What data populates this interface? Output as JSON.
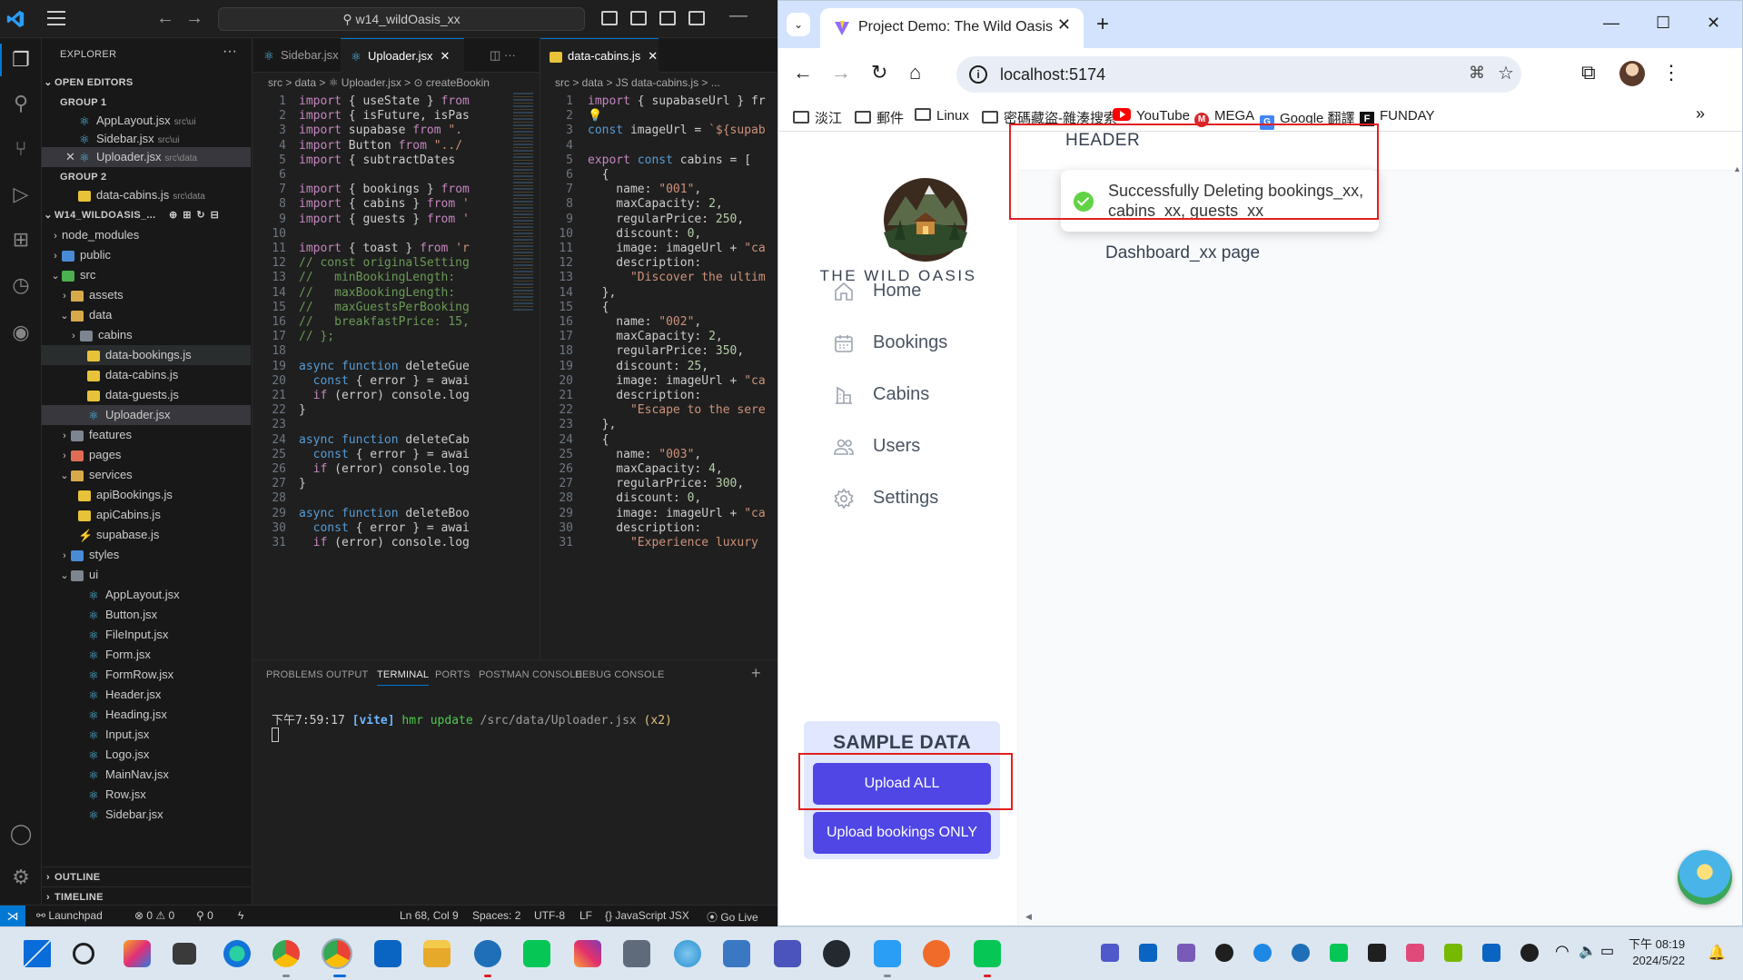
{
  "vscode": {
    "search": "w14_wildOasis_xx",
    "explorer": {
      "title": "EXPLORER",
      "open_editors": "OPEN EDITORS",
      "group1": "GROUP 1",
      "group2": "GROUP 2",
      "g1_files": [
        {
          "name": "AppLayout.jsx",
          "path": "src\\ui"
        },
        {
          "name": "Sidebar.jsx",
          "path": "src\\ui"
        },
        {
          "name": "Uploader.jsx",
          "path": "src\\data"
        }
      ],
      "g2_files": [
        {
          "name": "data-cabins.js",
          "path": "src\\data"
        }
      ],
      "project": "W14_WILDOASIS_...",
      "tree": [
        "node_modules",
        "public",
        "src",
        "assets",
        "data",
        "cabins",
        "data-bookings.js",
        "data-cabins.js",
        "data-guests.js",
        "Uploader.jsx",
        "features",
        "pages",
        "services",
        "apiBookings.js",
        "apiCabins.js",
        "supabase.js",
        "styles",
        "ui",
        "AppLayout.jsx",
        "Button.jsx",
        "FileInput.jsx",
        "Form.jsx",
        "FormRow.jsx",
        "Header.jsx",
        "Heading.jsx",
        "Input.jsx",
        "Logo.jsx",
        "MainNav.jsx",
        "Row.jsx",
        "Sidebar.jsx"
      ],
      "outline": "OUTLINE",
      "timeline": "TIMELINE"
    },
    "editor1": {
      "tabs": [
        "Sidebar.jsx",
        "Uploader.jsx"
      ],
      "crumb": "src > data > ⚛ Uploader.jsx > ⊙ createBookin",
      "lines": [
        "import { useState } from",
        "import { isFuture, isPas",
        "import supabase from \".",
        "import Button from \"../",
        "import { subtractDates",
        "",
        "import { bookings } from",
        "import { cabins } from '",
        "import { guests } from '",
        "",
        "import { toast } from 'r",
        "// const originalSetting",
        "//   minBookingLength: ",
        "//   maxBookingLength: ",
        "//   maxGuestsPerBooking",
        "//   breakfastPrice: 15,",
        "// };",
        "",
        "async function deleteGue",
        "  const { error } = awai",
        "  if (error) console.log",
        "}",
        "",
        "async function deleteCab",
        "  const { error } = awai",
        "  if (error) console.log",
        "}",
        "",
        "async function deleteBoo",
        "  const { error } = awai",
        "  if (error) console.log"
      ]
    },
    "editor2": {
      "tab": "data-cabins.js",
      "crumb": "src > data > JS data-cabins.js > ...",
      "lines": [
        "import { supabaseUrl } fr",
        "💡",
        "const imageUrl = `${supab",
        "",
        "export const cabins = [",
        "  {",
        "    name: \"001\",",
        "    maxCapacity: 2,",
        "    regularPrice: 250,",
        "    discount: 0,",
        "    image: imageUrl + \"ca",
        "    description:",
        "      \"Discover the ultim",
        "  },",
        "  {",
        "    name: \"002\",",
        "    maxCapacity: 2,",
        "    regularPrice: 350,",
        "    discount: 25,",
        "    image: imageUrl + \"ca",
        "    description:",
        "      \"Escape to the sere",
        "  },",
        "  {",
        "    name: \"003\",",
        "    maxCapacity: 4,",
        "    regularPrice: 300,",
        "    discount: 0,",
        "    image: imageUrl + \"ca",
        "    description:",
        "      \"Experience luxury"
      ]
    },
    "panel": {
      "tabs": [
        "PROBLEMS",
        "OUTPUT",
        "TERMINAL",
        "PORTS",
        "POSTMAN CONSOLE",
        "DEBUG CONSOLE"
      ],
      "terminal_time": "下午7:59:17",
      "terminal_tag": "[vite]",
      "terminal_msg": "hmr update",
      "terminal_path": "/src/data/Uploader.jsx",
      "terminal_count": "(x2)"
    },
    "status": {
      "launchpad": "Launchpad",
      "problems": "⊗ 0 ⚠ 0",
      "ports": "⚲ 0",
      "position": "Ln 68, Col 9",
      "spaces": "Spaces: 2",
      "encoding": "UTF-8",
      "eol": "LF",
      "language": "JavaScript JSX",
      "golive": "Go Live"
    }
  },
  "browser": {
    "tab_title": "Project Demo: The Wild Oasis",
    "url": "localhost:5174",
    "bookmarks": [
      "淡江",
      "郵件",
      "Linux",
      "密碼藏盜-雜湊搜索",
      "YouTube",
      "MEGA",
      "Google 翻譯",
      "FUNDAY"
    ],
    "app": {
      "header": "HEADER",
      "logo_text": "THE WILD OASIS",
      "nav": [
        "Home",
        "Bookings",
        "Cabins",
        "Users",
        "Settings"
      ],
      "main_text": "Dashboard_xx page",
      "sample_title": "SAMPLE DATA",
      "upload_all": "Upload ALL",
      "upload_bookings": "Upload bookings ONLY",
      "toast": "Successfully Deleting bookings_xx, cabins_xx, guests_xx"
    }
  },
  "taskbar": {
    "time": "下午 08:19",
    "date": "2024/5/22"
  },
  "colors": {
    "accent": "#4f46e5",
    "highlight": "#e02020",
    "vscode_blue": "#0078d4",
    "toast_success": "#61d345"
  }
}
